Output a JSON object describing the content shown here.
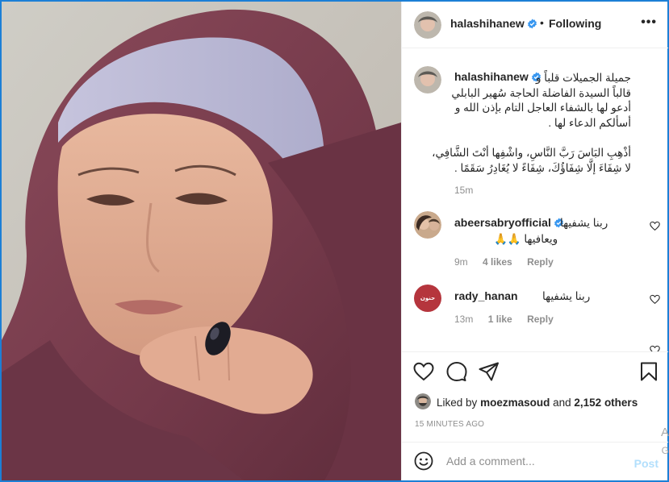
{
  "header": {
    "username": "halashihanew",
    "separator": "•",
    "follow_status": "Following",
    "more": "•••"
  },
  "caption": {
    "username": "halashihanew",
    "lines": [
      "جميلة الجميلات قلباً و",
      "قالباً السيدة الفاضلة الحاجة سُهير البابلي",
      "أدعو لها بالشفاء العاجل التام بإذن الله و",
      "أسألكم الدعاء لها .",
      "",
      "أذْهِبِ البَاسَ رَبَّ النَّاسِ، واشْفِها أنْتَ الشَّافِي،",
      "لا شِفَاءَ إلَّا شِفَاؤُكَ، شِفَاءً لا يُغَادِرُ سَقَمًا ."
    ],
    "time": "15m"
  },
  "comments": [
    {
      "username": "abeersabryofficial",
      "text_line1": "ربنا يشفيها",
      "text_line2": "ويعافيها 🙏🙏",
      "time": "9m",
      "likes": "4 likes",
      "reply": "Reply",
      "verified": true
    },
    {
      "username": "rady_hanan",
      "text_line1": "ربنا يشفيها",
      "time": "13m",
      "likes": "1 like",
      "reply": "Reply",
      "avatar_text": "حنون",
      "verified": false
    }
  ],
  "actions": {
    "liked_prefix": "Liked by",
    "liked_user": "moezmasoud",
    "liked_suffix": "and",
    "liked_others": "2,152 others",
    "time_ago": "15 MINUTES AGO"
  },
  "add_comment": {
    "placeholder": "Add a comment...",
    "post_label": "Post"
  },
  "overflow": {
    "side_a": "A",
    "side_g": "G"
  },
  "colors": {
    "verified_blue": "#3897f0",
    "post_disabled": "#b2dffc",
    "meta_gray": "#8e8e8e",
    "hijab_purple": "#7a3d4c",
    "avatar_red": "#b5353d",
    "frame_blue": "#1c7fd6"
  },
  "icons": [
    "heart-icon",
    "comment-icon",
    "share-icon",
    "bookmark-icon",
    "emoji-icon",
    "verified-icon",
    "more-icon"
  ]
}
